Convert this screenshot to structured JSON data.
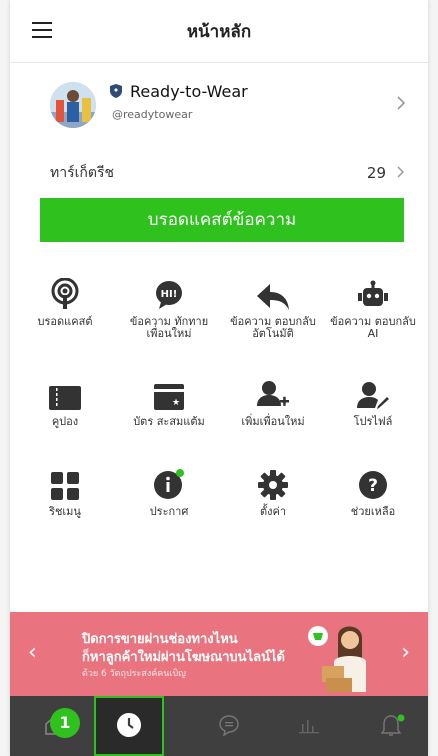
{
  "header": {
    "title": "หน้าหลัก"
  },
  "account": {
    "name": "Ready-to-Wear",
    "handle": "@readytowear"
  },
  "friends": {
    "label": "ทาร์เก็ตรีช",
    "count": "29"
  },
  "broadcast_button": "บรอดแคสต์ข้อความ",
  "grid": [
    {
      "label": "บรอดแคสต์",
      "icon": "broadcast-icon"
    },
    {
      "label": "ข้อความ ทักทาย เพื่อนใหม่",
      "icon": "hi-bubble-icon"
    },
    {
      "label": "ข้อความ ตอบกลับ อัตโนมัติ",
      "icon": "reply-icon"
    },
    {
      "label": "ข้อความ ตอบกลับ AI",
      "icon": "robot-icon"
    },
    {
      "label": "คูปอง",
      "icon": "coupon-icon"
    },
    {
      "label": "บัตร สะสมแต้ม",
      "icon": "reward-card-icon"
    },
    {
      "label": "เพิ่มเพื่อนใหม่",
      "icon": "add-friend-icon"
    },
    {
      "label": "โปรไฟล์",
      "icon": "profile-edit-icon"
    },
    {
      "label": "ริชเมนู",
      "icon": "rich-menu-icon"
    },
    {
      "label": "ประกาศ",
      "icon": "announcement-icon"
    },
    {
      "label": "ตั้งค่า",
      "icon": "gear-icon"
    },
    {
      "label": "ช่วยเหลือ",
      "icon": "help-icon"
    }
  ],
  "banner": {
    "line1": "ปิดการขายผ่านช่องทางไหน",
    "line2": "ก็หาลูกค้าใหม่ผ่านโฆษณาบนไลน์ได้",
    "line3": "ด้วย 6 วัตถุประสงค์คนเบิญ"
  },
  "bottom_tabs": [
    {
      "name": "home",
      "icon": "home-icon"
    },
    {
      "name": "history",
      "icon": "clock-icon",
      "active": true
    },
    {
      "name": "chat",
      "icon": "chat-icon"
    },
    {
      "name": "insight",
      "icon": "bar-chart-icon"
    },
    {
      "name": "notifications",
      "icon": "bell-icon"
    }
  ],
  "step_badge": "1",
  "colors": {
    "accent": "#2fc11d",
    "banner": "#e9737e",
    "bottombar": "#3f3f3f"
  }
}
